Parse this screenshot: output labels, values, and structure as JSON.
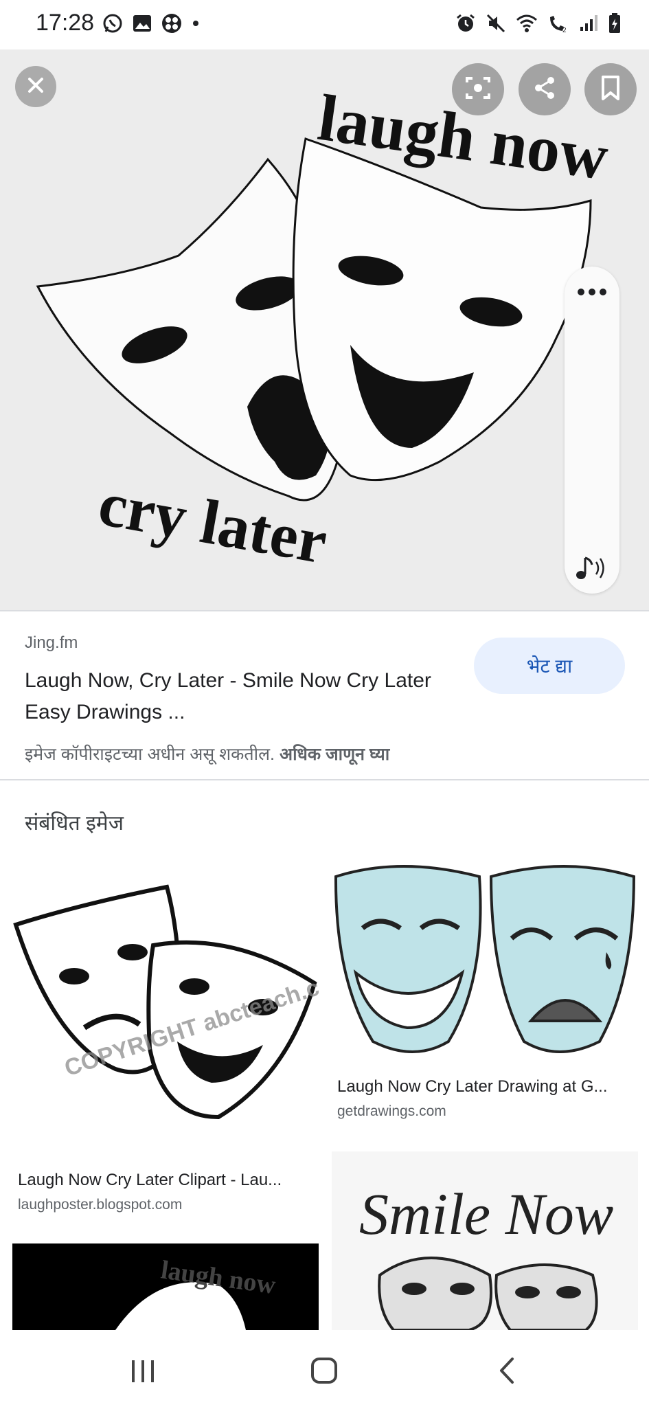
{
  "status_bar": {
    "time": "17:28",
    "left_icons": [
      "whatsapp-icon",
      "gallery-icon",
      "app-icon",
      "dot-icon"
    ],
    "right_icons": [
      "alarm-icon",
      "mute-icon",
      "wifi-icon",
      "wifi-calling-icon",
      "signal-icon",
      "battery-icon"
    ]
  },
  "hero": {
    "art_text_top": "laugh now",
    "art_text_bottom": "cry later",
    "buttons": [
      "close-icon",
      "lens-icon",
      "share-icon",
      "bookmark-icon"
    ]
  },
  "result": {
    "source": "Jing.fm",
    "title": "Laugh Now, Cry Later - Smile Now Cry Later Easy Drawings ...",
    "visit_label": "भेट द्या",
    "copyright_text": "इमेज कॉपीराइटच्या अधीन असू शकतील.",
    "learn_more": "अधिक जाणून घ्या"
  },
  "related": {
    "heading": "संबंधित इमेज",
    "cards": [
      {
        "title": "Laugh Now Cry Later Clipart - Lau...",
        "source": "laughposter.blogspot.com",
        "watermark": "COPYRIGHT abcteach.com"
      },
      {
        "title": "Laugh Now Cry Later Drawing at G...",
        "source": "getdrawings.com"
      },
      {
        "art_text": "laugh now"
      },
      {
        "art_text": "Smile Now"
      }
    ]
  },
  "nav": {
    "buttons": [
      "recents-icon",
      "home-icon",
      "back-icon"
    ]
  },
  "colors": {
    "accent": "#1a56b5",
    "chip_bg": "#e8f0fe",
    "secondary_text": "#5f6368"
  }
}
